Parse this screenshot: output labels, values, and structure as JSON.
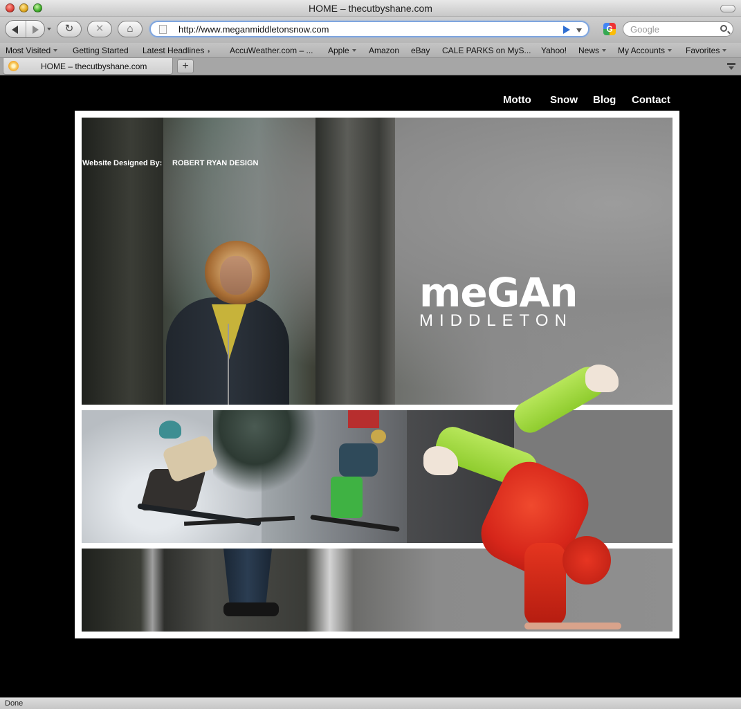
{
  "window": {
    "title": "HOME – thecutbyshane.com"
  },
  "toolbar": {
    "url": "http://www.meganmiddletonsnow.com",
    "search_placeholder": "Google",
    "reload_icon": "reload-icon",
    "stop_icon": "stop-icon",
    "home_icon": "home-icon"
  },
  "bookmarks": [
    {
      "label": "Most Visited",
      "dropdown": true
    },
    {
      "label": "Getting Started",
      "dropdown": false
    },
    {
      "label": "Latest Headlines",
      "dropdown": false,
      "rss": true
    },
    {
      "label": "AccuWeather.com – ...",
      "dropdown": false
    },
    {
      "label": "Apple",
      "dropdown": true
    },
    {
      "label": "Amazon",
      "dropdown": false
    },
    {
      "label": "eBay",
      "dropdown": false
    },
    {
      "label": "CALE PARKS on MyS...",
      "dropdown": false
    },
    {
      "label": "Yahoo!",
      "dropdown": false
    },
    {
      "label": "News",
      "dropdown": true
    },
    {
      "label": "My Accounts",
      "dropdown": true
    },
    {
      "label": "Favorites",
      "dropdown": true
    }
  ],
  "tabs": [
    {
      "label": "HOME – thecutbyshane.com",
      "active": true
    }
  ],
  "site": {
    "nav": [
      "Motto",
      "Snow",
      "Blog",
      "Contact"
    ],
    "logo_main": "meGAn",
    "logo_sub": "MIDDLETON",
    "credit_label": "Website Designed By:",
    "credit_name": "ROBERT RYAN DESIGN"
  },
  "status": {
    "text": "Done"
  },
  "colors": {
    "page_bg": "#000000",
    "frame": "#ffffff",
    "url_focus": "#7fa6df",
    "acrobat_jacket": "#d6261a",
    "acrobat_pants": "#a7dc47"
  }
}
